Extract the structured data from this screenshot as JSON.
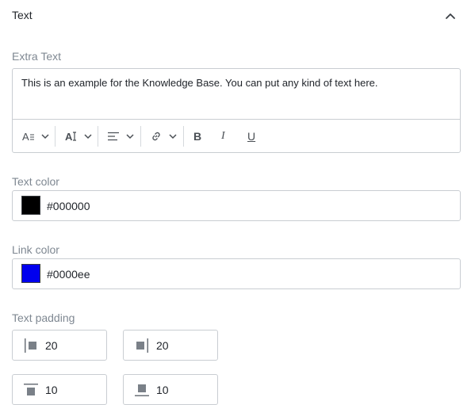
{
  "section": {
    "title": "Text"
  },
  "extra_text": {
    "label": "Extra Text",
    "value": "This is an example for the Knowledge Base. You can put any kind of text here.",
    "toolbar": {
      "font_size_icon": "font-size-icon",
      "font_family_icon": "font-family-icon",
      "align_icon": "align-left-icon",
      "link_icon": "link-icon",
      "bold": "B",
      "italic": "I",
      "underline": "U"
    }
  },
  "text_color": {
    "label": "Text color",
    "value": "#000000",
    "swatch": "#000000"
  },
  "link_color": {
    "label": "Link color",
    "value": "#0000ee",
    "swatch": "#0000ee"
  },
  "text_padding": {
    "label": "Text padding",
    "left": "20",
    "right": "20",
    "top": "10",
    "bottom": "10"
  }
}
